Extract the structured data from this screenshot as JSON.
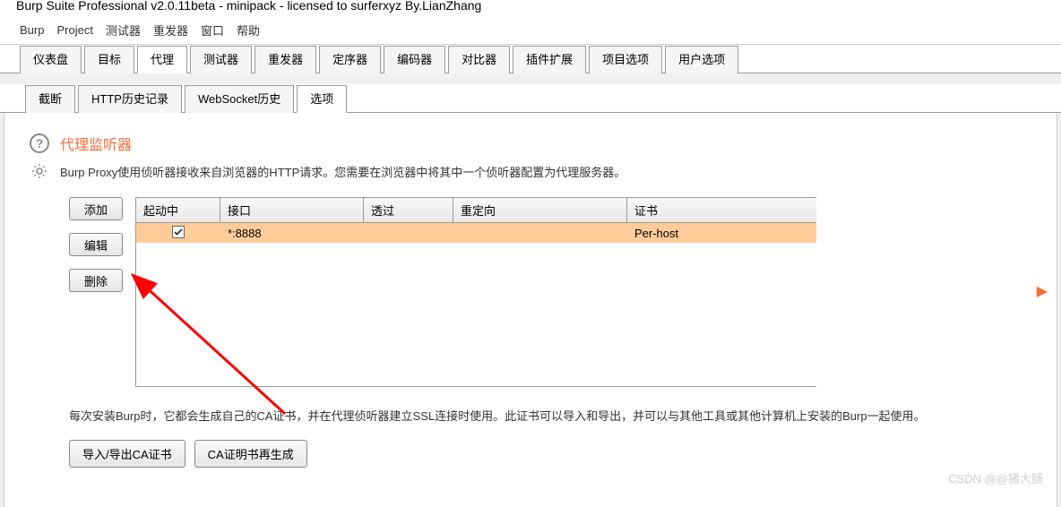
{
  "window": {
    "title": "Burp Suite Professional v2.0.11beta - minipack - licensed to surferxyz By.LianZhang"
  },
  "menubar": {
    "items": [
      "Burp",
      "Project",
      "测试器",
      "重发器",
      "窗口",
      "帮助"
    ]
  },
  "main_tabs": {
    "items": [
      "仪表盘",
      "目标",
      "代理",
      "测试器",
      "重发器",
      "定序器",
      "编码器",
      "对比器",
      "插件扩展",
      "项目选项",
      "用户选项"
    ],
    "active_index": 2
  },
  "sub_tabs": {
    "items": [
      "截断",
      "HTTP历史记录",
      "WebSocket历史",
      "选项"
    ],
    "active_index": 3
  },
  "proxy_section": {
    "title": "代理监听器",
    "description": "Burp Proxy使用侦听器接收来自浏览器的HTTP请求。您需要在浏览器中将其中一个侦听器配置为代理服务器。"
  },
  "panel_buttons": {
    "add": "添加",
    "edit": "编辑",
    "delete": "删除"
  },
  "table": {
    "headers": {
      "running": "起动中",
      "interface": "接口",
      "invisible": "透过",
      "redirect": "重定向",
      "certificate": "证书"
    },
    "rows": [
      {
        "running": true,
        "interface": "*:8888",
        "invisible": "",
        "redirect": "",
        "certificate": "Per-host"
      }
    ]
  },
  "ca_section": {
    "description": "每次安装Burp时，它都会生成自己的CA证书，并在代理侦听器建立SSL连接时使用。此证书可以导入和导出，并可以与其他工具或其他计算机上安装的Burp一起使用。",
    "import_export": "导入/导出CA证书",
    "regenerate": "CA证明书再生成"
  },
  "watermark": "CSDN @@猪大肠"
}
